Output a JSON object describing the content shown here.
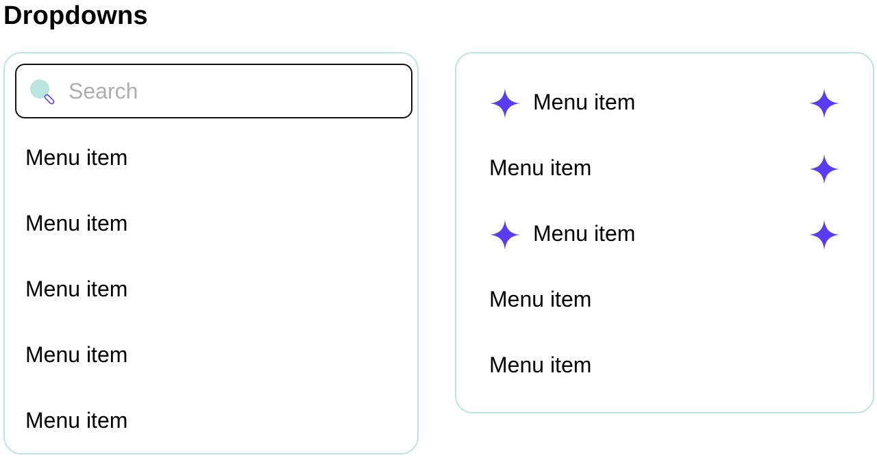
{
  "page": {
    "title": "Dropdowns"
  },
  "colors": {
    "accent": "#5b3cf5",
    "border": "#b9e4df",
    "search_icon": "#b9e4df",
    "placeholder": "#aeaeae"
  },
  "left_dropdown": {
    "search": {
      "placeholder": "Search",
      "value": ""
    },
    "items": [
      {
        "label": "Menu item"
      },
      {
        "label": "Menu item"
      },
      {
        "label": "Menu item"
      },
      {
        "label": "Menu item"
      },
      {
        "label": "Menu item"
      }
    ]
  },
  "right_dropdown": {
    "icon": "sparkle-icon",
    "items": [
      {
        "label": "Menu item",
        "lead_icon": true,
        "trail_icon": true
      },
      {
        "label": "Menu item",
        "lead_icon": false,
        "trail_icon": true
      },
      {
        "label": "Menu item",
        "lead_icon": true,
        "trail_icon": true
      },
      {
        "label": "Menu item",
        "lead_icon": false,
        "trail_icon": false
      },
      {
        "label": "Menu item",
        "lead_icon": false,
        "trail_icon": false
      }
    ]
  }
}
